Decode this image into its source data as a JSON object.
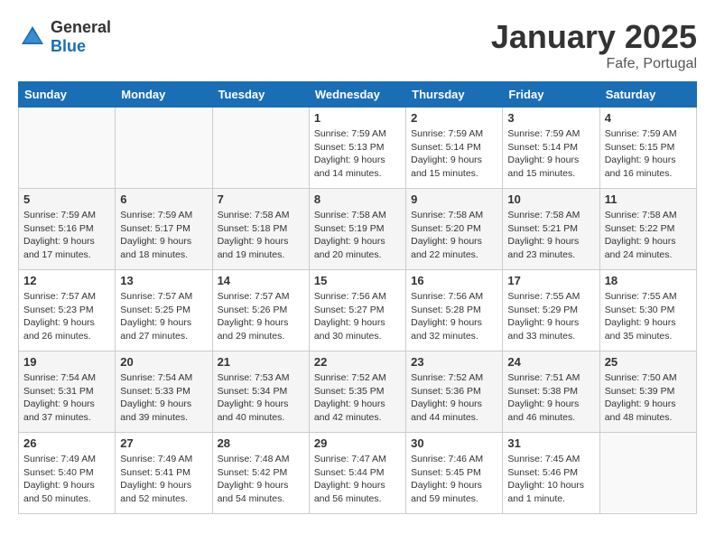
{
  "header": {
    "logo_general": "General",
    "logo_blue": "Blue",
    "month": "January 2025",
    "location": "Fafe, Portugal"
  },
  "weekdays": [
    "Sunday",
    "Monday",
    "Tuesday",
    "Wednesday",
    "Thursday",
    "Friday",
    "Saturday"
  ],
  "weeks": [
    [
      {
        "day": "",
        "info": ""
      },
      {
        "day": "",
        "info": ""
      },
      {
        "day": "",
        "info": ""
      },
      {
        "day": "1",
        "info": "Sunrise: 7:59 AM\nSunset: 5:13 PM\nDaylight: 9 hours\nand 14 minutes."
      },
      {
        "day": "2",
        "info": "Sunrise: 7:59 AM\nSunset: 5:14 PM\nDaylight: 9 hours\nand 15 minutes."
      },
      {
        "day": "3",
        "info": "Sunrise: 7:59 AM\nSunset: 5:14 PM\nDaylight: 9 hours\nand 15 minutes."
      },
      {
        "day": "4",
        "info": "Sunrise: 7:59 AM\nSunset: 5:15 PM\nDaylight: 9 hours\nand 16 minutes."
      }
    ],
    [
      {
        "day": "5",
        "info": "Sunrise: 7:59 AM\nSunset: 5:16 PM\nDaylight: 9 hours\nand 17 minutes."
      },
      {
        "day": "6",
        "info": "Sunrise: 7:59 AM\nSunset: 5:17 PM\nDaylight: 9 hours\nand 18 minutes."
      },
      {
        "day": "7",
        "info": "Sunrise: 7:58 AM\nSunset: 5:18 PM\nDaylight: 9 hours\nand 19 minutes."
      },
      {
        "day": "8",
        "info": "Sunrise: 7:58 AM\nSunset: 5:19 PM\nDaylight: 9 hours\nand 20 minutes."
      },
      {
        "day": "9",
        "info": "Sunrise: 7:58 AM\nSunset: 5:20 PM\nDaylight: 9 hours\nand 22 minutes."
      },
      {
        "day": "10",
        "info": "Sunrise: 7:58 AM\nSunset: 5:21 PM\nDaylight: 9 hours\nand 23 minutes."
      },
      {
        "day": "11",
        "info": "Sunrise: 7:58 AM\nSunset: 5:22 PM\nDaylight: 9 hours\nand 24 minutes."
      }
    ],
    [
      {
        "day": "12",
        "info": "Sunrise: 7:57 AM\nSunset: 5:23 PM\nDaylight: 9 hours\nand 26 minutes."
      },
      {
        "day": "13",
        "info": "Sunrise: 7:57 AM\nSunset: 5:25 PM\nDaylight: 9 hours\nand 27 minutes."
      },
      {
        "day": "14",
        "info": "Sunrise: 7:57 AM\nSunset: 5:26 PM\nDaylight: 9 hours\nand 29 minutes."
      },
      {
        "day": "15",
        "info": "Sunrise: 7:56 AM\nSunset: 5:27 PM\nDaylight: 9 hours\nand 30 minutes."
      },
      {
        "day": "16",
        "info": "Sunrise: 7:56 AM\nSunset: 5:28 PM\nDaylight: 9 hours\nand 32 minutes."
      },
      {
        "day": "17",
        "info": "Sunrise: 7:55 AM\nSunset: 5:29 PM\nDaylight: 9 hours\nand 33 minutes."
      },
      {
        "day": "18",
        "info": "Sunrise: 7:55 AM\nSunset: 5:30 PM\nDaylight: 9 hours\nand 35 minutes."
      }
    ],
    [
      {
        "day": "19",
        "info": "Sunrise: 7:54 AM\nSunset: 5:31 PM\nDaylight: 9 hours\nand 37 minutes."
      },
      {
        "day": "20",
        "info": "Sunrise: 7:54 AM\nSunset: 5:33 PM\nDaylight: 9 hours\nand 39 minutes."
      },
      {
        "day": "21",
        "info": "Sunrise: 7:53 AM\nSunset: 5:34 PM\nDaylight: 9 hours\nand 40 minutes."
      },
      {
        "day": "22",
        "info": "Sunrise: 7:52 AM\nSunset: 5:35 PM\nDaylight: 9 hours\nand 42 minutes."
      },
      {
        "day": "23",
        "info": "Sunrise: 7:52 AM\nSunset: 5:36 PM\nDaylight: 9 hours\nand 44 minutes."
      },
      {
        "day": "24",
        "info": "Sunrise: 7:51 AM\nSunset: 5:38 PM\nDaylight: 9 hours\nand 46 minutes."
      },
      {
        "day": "25",
        "info": "Sunrise: 7:50 AM\nSunset: 5:39 PM\nDaylight: 9 hours\nand 48 minutes."
      }
    ],
    [
      {
        "day": "26",
        "info": "Sunrise: 7:49 AM\nSunset: 5:40 PM\nDaylight: 9 hours\nand 50 minutes."
      },
      {
        "day": "27",
        "info": "Sunrise: 7:49 AM\nSunset: 5:41 PM\nDaylight: 9 hours\nand 52 minutes."
      },
      {
        "day": "28",
        "info": "Sunrise: 7:48 AM\nSunset: 5:42 PM\nDaylight: 9 hours\nand 54 minutes."
      },
      {
        "day": "29",
        "info": "Sunrise: 7:47 AM\nSunset: 5:44 PM\nDaylight: 9 hours\nand 56 minutes."
      },
      {
        "day": "30",
        "info": "Sunrise: 7:46 AM\nSunset: 5:45 PM\nDaylight: 9 hours\nand 59 minutes."
      },
      {
        "day": "31",
        "info": "Sunrise: 7:45 AM\nSunset: 5:46 PM\nDaylight: 10 hours\nand 1 minute."
      },
      {
        "day": "",
        "info": ""
      }
    ]
  ]
}
